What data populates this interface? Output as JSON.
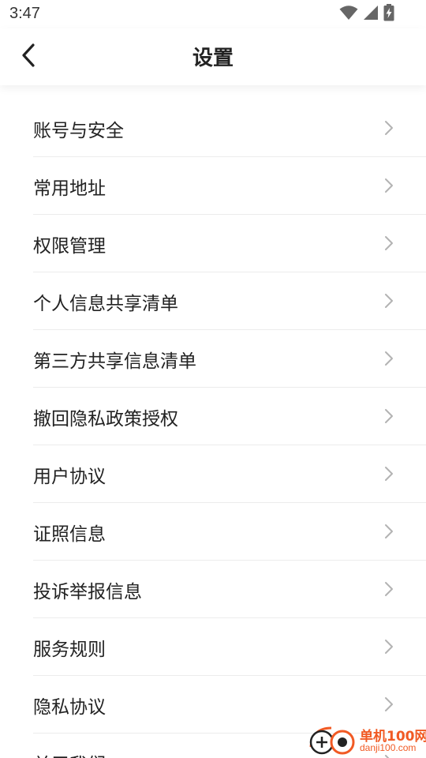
{
  "status_bar": {
    "time": "3:47",
    "icons": [
      "wifi-icon",
      "cellular-signal-icon",
      "battery-charging-icon"
    ]
  },
  "header": {
    "back_icon": "chevron-left-icon",
    "title": "设置"
  },
  "settings": {
    "items": [
      {
        "label": "账号与安全"
      },
      {
        "label": "常用地址"
      },
      {
        "label": "权限管理"
      },
      {
        "label": "个人信息共享清单"
      },
      {
        "label": "第三方共享信息清单"
      },
      {
        "label": "撤回隐私政策授权"
      },
      {
        "label": "用户协议"
      },
      {
        "label": "证照信息"
      },
      {
        "label": "投诉举报信息"
      },
      {
        "label": "服务规则"
      },
      {
        "label": "隐私协议"
      },
      {
        "label": "关于我们"
      }
    ],
    "row_icon": "chevron-right-icon"
  },
  "watermark": {
    "brand": "单机100网",
    "domain": "danji100.com",
    "color": "#f15a24"
  },
  "colors": {
    "text": "#222222",
    "divider": "#ececec",
    "chevron": "#b3b3b3",
    "background": "#ffffff"
  }
}
